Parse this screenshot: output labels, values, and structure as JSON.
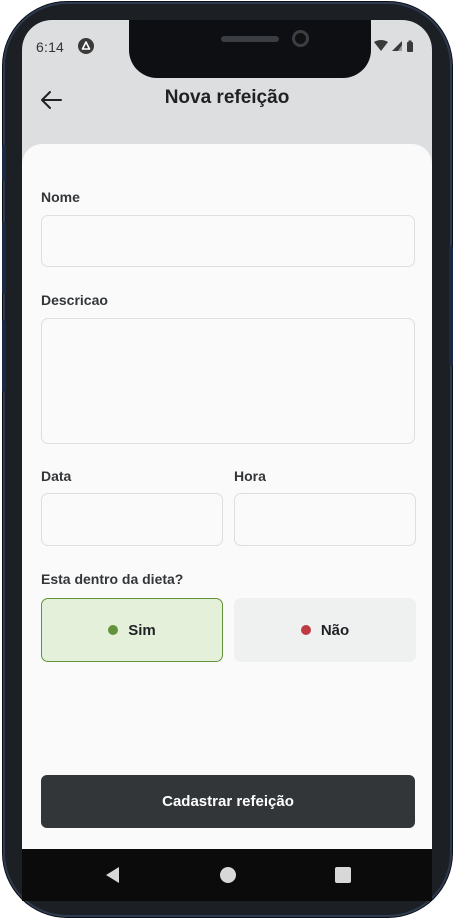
{
  "status_bar": {
    "time": "6:14",
    "app_icon": "app-notification-icon",
    "wifi_icon": "wifi-icon",
    "signal_icon": "cell-signal-icon",
    "battery_icon": "battery-icon"
  },
  "header": {
    "title": "Nova refeição",
    "back_icon": "arrow-left-icon"
  },
  "form": {
    "name_label": "Nome",
    "name_value": "",
    "description_label": "Descricao",
    "description_value": "",
    "date_label": "Data",
    "date_value": "",
    "time_label": "Hora",
    "time_value": "",
    "diet_question": "Esta dentro da dieta?",
    "options": [
      {
        "label": "Sim",
        "selected": true,
        "dot_color": "#639339"
      },
      {
        "label": "Não",
        "selected": false,
        "dot_color": "#bf3b44"
      }
    ],
    "submit_label": "Cadastrar refeição"
  },
  "nav_bar": {
    "back_icon": "nav-back-triangle-icon",
    "home_icon": "nav-home-circle-icon",
    "recents_icon": "nav-recents-square-icon"
  },
  "colors": {
    "header_bg": "#dddee0",
    "content_bg": "#fafafa",
    "selected_bg": "#e5f0db",
    "selected_border": "#639339",
    "unselected_bg": "#eff0f0",
    "button_bg": "#333638",
    "green": "#639339",
    "red": "#bf3b44"
  }
}
